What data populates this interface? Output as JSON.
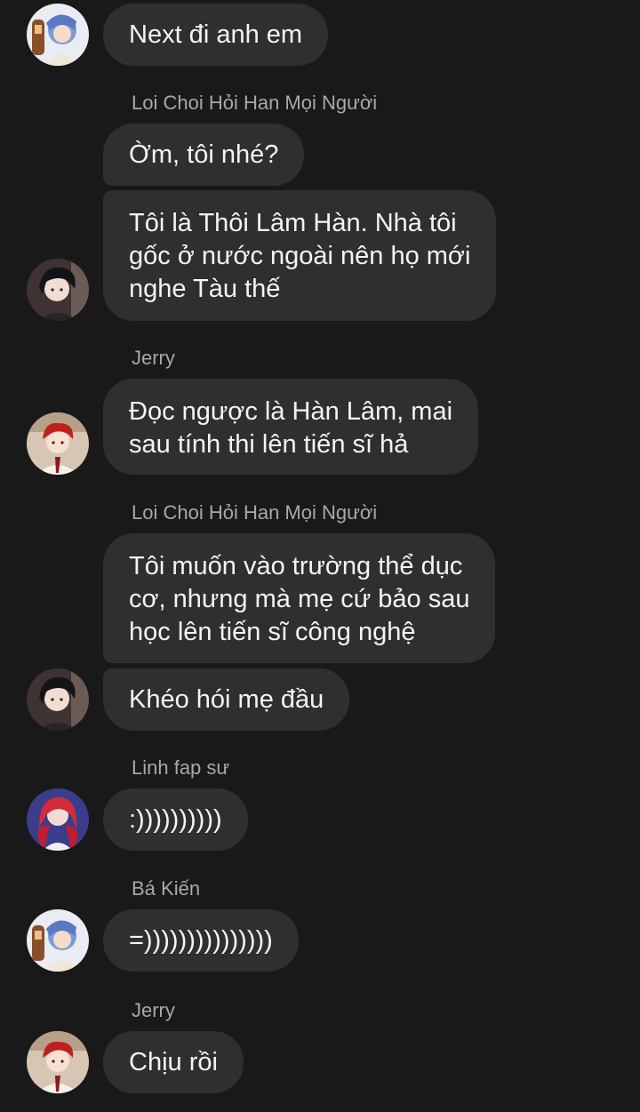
{
  "messages": [
    {
      "sender": "",
      "text": "Next đi anh em",
      "avatar": "avatar-blue-hair-person"
    },
    {
      "sender": "Loi Choi Hỏi Han Mọi Người",
      "text": "Ờm, tôi nhé?",
      "avatar": ""
    },
    {
      "sender": "",
      "text": "Tôi là Thôi Lâm Hàn. Nhà tôi\ngốc ở nước ngoài nên họ mới\nnghe Tàu thế",
      "avatar": "avatar-dark-hair-man"
    },
    {
      "sender": "Jerry",
      "text": "Đọc ngược là Hàn Lâm, mai\nsau tính thi lên tiến sĩ hả",
      "avatar": "avatar-red-hair-man"
    },
    {
      "sender": "Loi Choi Hỏi Han Mọi Người",
      "text": "Tôi muốn vào trường thể dục\ncơ, nhưng mà mẹ cứ bảo sau\nhọc lên tiến sĩ công nghệ",
      "avatar": ""
    },
    {
      "sender": "",
      "text": "Khéo hói mẹ đầu",
      "avatar": "avatar-dark-hair-man"
    },
    {
      "sender": "Linh fap sư",
      "text": ":))))))))))",
      "avatar": "avatar-red-hair-woman"
    },
    {
      "sender": "Bá Kiến",
      "text": "=)))))))))))))))",
      "avatar": "avatar-blue-hair-person"
    },
    {
      "sender": "Jerry",
      "text": "Chịu rồi",
      "avatar": "avatar-red-hair-man"
    }
  ],
  "colors": {
    "background": "#191919",
    "bubble": "#2f2f2f",
    "sender_name": "#a8a8a8",
    "message_text": "#f4f4f4"
  }
}
